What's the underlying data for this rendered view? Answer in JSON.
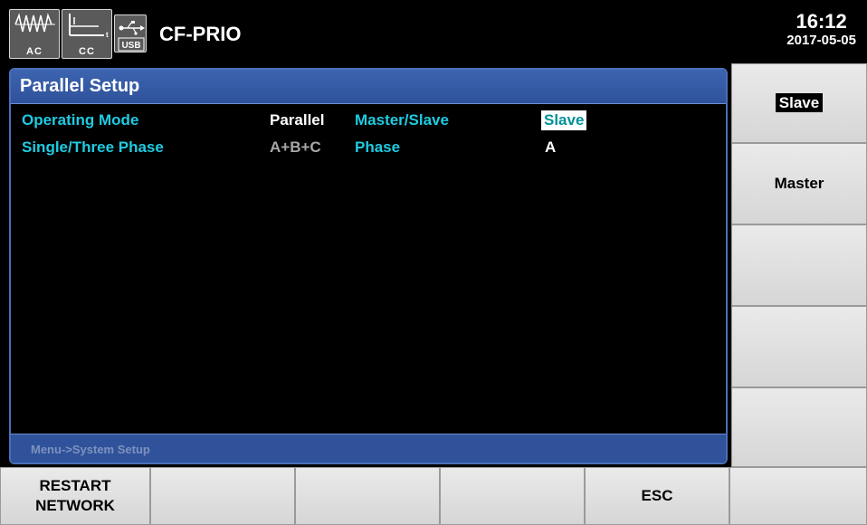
{
  "topbar": {
    "icons": [
      {
        "name": "ac-waveform-icon",
        "label": "AC"
      },
      {
        "name": "cc-graph-icon",
        "label": "CC"
      },
      {
        "name": "usb-icon",
        "label": "USB"
      }
    ],
    "title": "CF-PRIO",
    "time": "16:12",
    "date": "2017-05-05"
  },
  "panel": {
    "title": "Parallel Setup",
    "rows": [
      {
        "label": "Operating Mode",
        "value": "Parallel",
        "label2": "Master/Slave",
        "value2": "Slave"
      },
      {
        "label": "Single/Three Phase",
        "value": "A+B+C",
        "label2": "Phase",
        "value2": "A"
      }
    ],
    "breadcrumb": "Menu->System Setup"
  },
  "softkeys_right": [
    "Slave",
    "Master",
    "",
    "",
    ""
  ],
  "softkeys_bottom": [
    {
      "line1": "RESTART",
      "line2": "NETWORK"
    },
    {
      "line1": "",
      "line2": ""
    },
    {
      "line1": "",
      "line2": ""
    },
    {
      "line1": "",
      "line2": ""
    },
    {
      "line1": "ESC",
      "line2": ""
    },
    {
      "line1": "",
      "line2": ""
    }
  ],
  "colors": {
    "accent_label": "#1ecbe1",
    "panel_header": "#2f529b",
    "highlight_text": "#00909a"
  }
}
